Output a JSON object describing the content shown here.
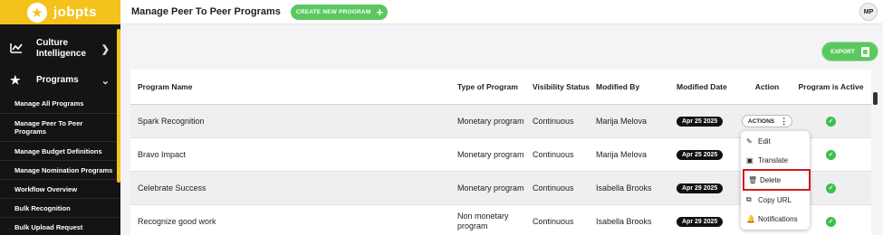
{
  "brand": {
    "name": "jobpts",
    "logo_icon": "star-icon"
  },
  "sidebar": {
    "sections": [
      {
        "label": "Culture Intelligence",
        "icon": "chart-line-icon",
        "chevron": "chevron-right-icon"
      },
      {
        "label": "Programs",
        "icon": "star-icon",
        "chevron": "chevron-down-icon"
      }
    ],
    "items": [
      {
        "label": "Manage All Programs"
      },
      {
        "label": "Manage Peer To Peer Programs"
      },
      {
        "label": "Manage Budget Definitions"
      },
      {
        "label": "Manage Nomination Programs"
      },
      {
        "label": "Workflow Overview"
      },
      {
        "label": "Bulk Recognition"
      },
      {
        "label": "Bulk Upload Request"
      }
    ]
  },
  "header": {
    "title": "Manage Peer To Peer Programs",
    "create_label": "CREATE NEW PROGRAM",
    "avatar_initials": "MP"
  },
  "export_label": "EXPORT",
  "table": {
    "columns": [
      "Program Name",
      "Type of Program",
      "Visibility Status",
      "Modified By",
      "Modified Date",
      "Action",
      "Program is Active"
    ],
    "rows": [
      {
        "name": "Spark Recognition",
        "type": "Monetary program",
        "visibility": "Continuous",
        "modified_by": "Marija Melova",
        "modified_date": "Apr 25 2025",
        "active": true
      },
      {
        "name": "Bravo Impact",
        "type": "Monetary program",
        "visibility": "Continuous",
        "modified_by": "Marija Melova",
        "modified_date": "Apr 25 2025",
        "active": true
      },
      {
        "name": "Celebrate Success",
        "type": "Monetary program",
        "visibility": "Continuous",
        "modified_by": "Isabella Brooks",
        "modified_date": "Apr 29 2025",
        "active": true
      },
      {
        "name": "Recognize good work",
        "type": "Non monetary program",
        "visibility": "Continuous",
        "modified_by": "Isabella Brooks",
        "modified_date": "Apr 29 2025",
        "active": true
      }
    ],
    "actions_label": "ACTIONS"
  },
  "menu": {
    "items": [
      {
        "label": "Edit",
        "icon": "pencil-icon"
      },
      {
        "label": "Translate",
        "icon": "translate-icon"
      },
      {
        "label": "Delete",
        "icon": "trash-icon",
        "highlighted": true
      },
      {
        "label": "Copy URL",
        "icon": "copy-icon"
      },
      {
        "label": "Notifications",
        "icon": "bell-icon"
      }
    ]
  },
  "colors": {
    "brand": "#f5c21b",
    "sidebar": "#141414",
    "accent": "#5ac85e",
    "highlight": "#d01b1b"
  }
}
